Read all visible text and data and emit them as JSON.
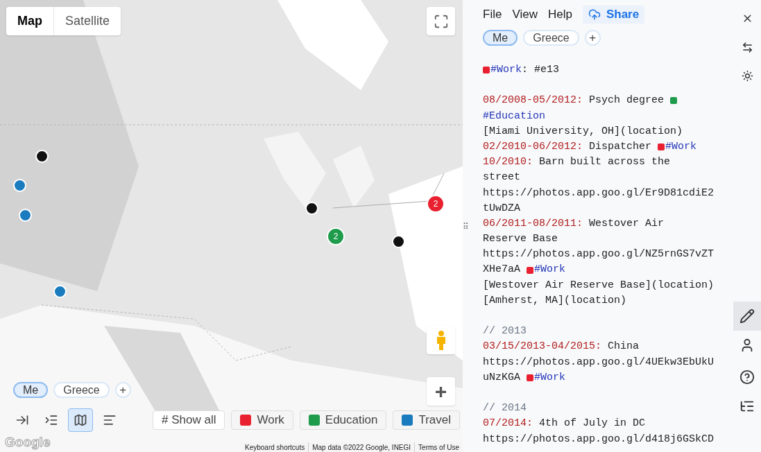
{
  "map": {
    "map_type_tabs": [
      {
        "label": "Map",
        "selected": true
      },
      {
        "label": "Satellite",
        "selected": false
      }
    ],
    "markers": [
      {
        "color": "#111111"
      },
      {
        "color": "#1a7bbf"
      },
      {
        "color": "#1a7bbf"
      },
      {
        "color": "#1a7bbf"
      },
      {
        "color": "#111111"
      },
      {
        "color": "#1e9b4b",
        "count": "2"
      },
      {
        "color": "#111111"
      },
      {
        "color": "#e8202f",
        "count": "2"
      }
    ],
    "zoom_in": "+",
    "timeline_tabs": [
      {
        "label": "Me",
        "selected": true
      },
      {
        "label": "Greece",
        "selected": false
      }
    ],
    "add_tab": "+",
    "view_buttons": [
      {
        "kind": "collapse",
        "selected": false
      },
      {
        "kind": "outline",
        "selected": false
      },
      {
        "kind": "map",
        "selected": true
      },
      {
        "kind": "text",
        "selected": false
      }
    ],
    "filters": [
      {
        "label": "# Show all",
        "kind": "all"
      },
      {
        "label": "Work",
        "kind": "tag",
        "color": "#e8202f"
      },
      {
        "label": "Education",
        "kind": "tag",
        "color": "#1e9b4b"
      },
      {
        "label": "Travel",
        "kind": "tag",
        "color": "#1a7bbf"
      }
    ],
    "logo": "Google",
    "footer": [
      "Keyboard shortcuts",
      "Map data ©2022 Google, INEGI",
      "Terms of Use"
    ]
  },
  "editor": {
    "menu": [
      "File",
      "View",
      "Help"
    ],
    "share": "Share",
    "timeline_tabs": [
      {
        "label": "Me",
        "selected": true
      },
      {
        "label": "Greece",
        "selected": false
      }
    ],
    "add_tab": "+",
    "drag_handle": "⠿",
    "lines": [
      {
        "kind": "line",
        "segments": [
          {
            "kind": "tag",
            "text": "#Work",
            "color": "#e8202f"
          },
          {
            "kind": "text",
            "text": ": #e13"
          }
        ]
      },
      {
        "kind": "blank"
      },
      {
        "kind": "line",
        "segments": [
          {
            "kind": "date",
            "text": "08/2008-05/2012:"
          },
          {
            "kind": "text",
            "text": " Psych degree "
          },
          {
            "kind": "swatch",
            "color": "#1e9b4b"
          }
        ]
      },
      {
        "kind": "line",
        "segments": [
          {
            "kind": "tag",
            "text": "#Education"
          }
        ]
      },
      {
        "kind": "line",
        "segments": [
          {
            "kind": "text",
            "text": "[Miami University, OH](location)"
          }
        ]
      },
      {
        "kind": "line",
        "segments": [
          {
            "kind": "date",
            "text": "02/2010-06/2012:"
          },
          {
            "kind": "text",
            "text": " Dispatcher "
          },
          {
            "kind": "tag",
            "text": "#Work",
            "color": "#e8202f"
          }
        ]
      },
      {
        "kind": "line",
        "segments": [
          {
            "kind": "date",
            "text": "10/2010:"
          },
          {
            "kind": "text",
            "text": " Barn built across the"
          }
        ]
      },
      {
        "kind": "line",
        "segments": [
          {
            "kind": "text",
            "text": "street"
          }
        ]
      },
      {
        "kind": "line",
        "segments": [
          {
            "kind": "text",
            "text": "https://photos.app.goo.gl/Er9D81cdiE2"
          }
        ]
      },
      {
        "kind": "line",
        "segments": [
          {
            "kind": "text",
            "text": "tUwDZA"
          }
        ]
      },
      {
        "kind": "line",
        "segments": [
          {
            "kind": "date",
            "text": "06/2011-08/2011:"
          },
          {
            "kind": "text",
            "text": " Westover Air"
          }
        ]
      },
      {
        "kind": "line",
        "segments": [
          {
            "kind": "text",
            "text": "Reserve Base"
          }
        ]
      },
      {
        "kind": "line",
        "segments": [
          {
            "kind": "text",
            "text": "https://photos.app.goo.gl/NZ5rnGS7vZT"
          }
        ]
      },
      {
        "kind": "line",
        "segments": [
          {
            "kind": "text",
            "text": "XHe7aA "
          },
          {
            "kind": "tag",
            "text": "#Work",
            "color": "#e8202f"
          }
        ]
      },
      {
        "kind": "line",
        "segments": [
          {
            "kind": "text",
            "text": "[Westover Air Reserve Base](location)"
          }
        ]
      },
      {
        "kind": "line",
        "segments": [
          {
            "kind": "text",
            "text": "[Amherst, MA](location)"
          }
        ]
      },
      {
        "kind": "blank"
      },
      {
        "kind": "line",
        "segments": [
          {
            "kind": "comment",
            "text": "// 2013"
          }
        ]
      },
      {
        "kind": "line",
        "segments": [
          {
            "kind": "date",
            "text": "03/15/2013-04/2015:"
          },
          {
            "kind": "text",
            "text": " China"
          }
        ]
      },
      {
        "kind": "line",
        "segments": [
          {
            "kind": "text",
            "text": "https://photos.app.goo.gl/4UEkw3EbUkU"
          }
        ]
      },
      {
        "kind": "line",
        "segments": [
          {
            "kind": "text",
            "text": "uNzKGA "
          },
          {
            "kind": "tag",
            "text": "#Work",
            "color": "#e8202f"
          }
        ]
      },
      {
        "kind": "blank"
      },
      {
        "kind": "line",
        "segments": [
          {
            "kind": "comment",
            "text": "// 2014"
          }
        ]
      },
      {
        "kind": "line",
        "segments": [
          {
            "kind": "date",
            "text": "07/2014:"
          },
          {
            "kind": "text",
            "text": " 4th of July in DC"
          }
        ]
      },
      {
        "kind": "line",
        "segments": [
          {
            "kind": "text",
            "text": "https://photos.app.goo.gl/d418j6GSkCD"
          }
        ]
      }
    ],
    "side_tools": [
      {
        "kind": "close",
        "selected": false
      },
      {
        "kind": "swap",
        "selected": false
      },
      {
        "kind": "theme",
        "selected": false
      },
      {
        "kind": "edit",
        "selected": true
      },
      {
        "kind": "profile",
        "selected": false
      },
      {
        "kind": "help",
        "selected": false
      },
      {
        "kind": "outline",
        "selected": false
      }
    ]
  }
}
